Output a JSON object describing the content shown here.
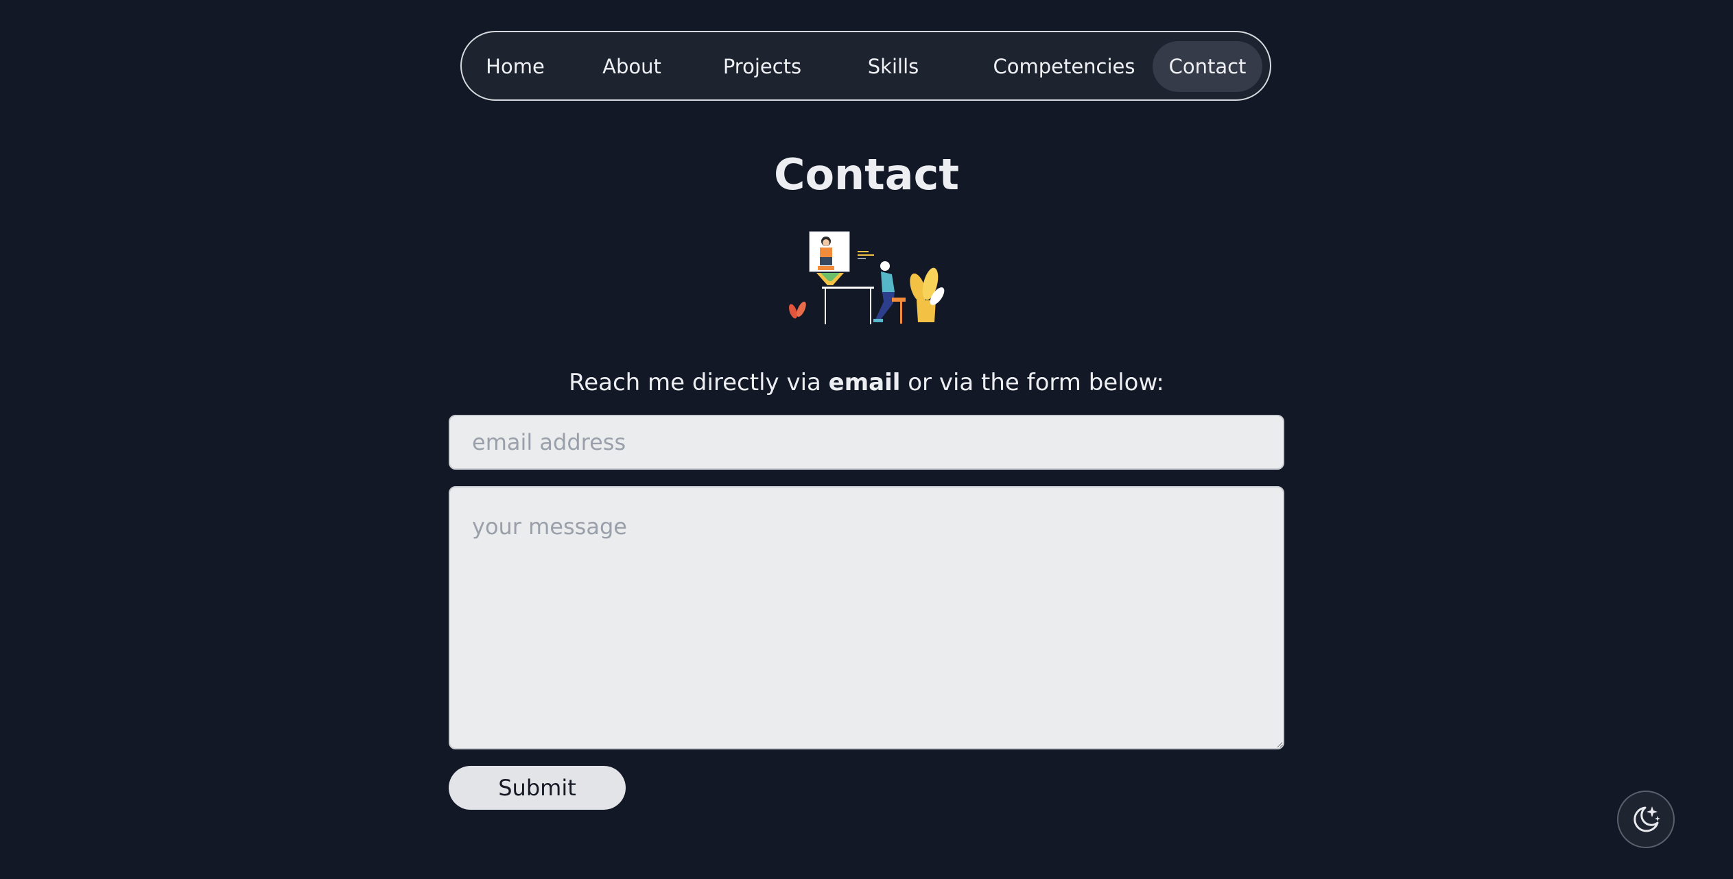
{
  "nav": {
    "items": [
      {
        "label": "Home"
      },
      {
        "label": "About"
      },
      {
        "label": "Projects"
      },
      {
        "label": "Skills"
      },
      {
        "label": "Competencies"
      },
      {
        "label": "Contact",
        "active": true
      }
    ]
  },
  "contact": {
    "title": "Contact",
    "intro_prefix": "Reach me directly via ",
    "intro_link": "email",
    "intro_suffix": " or via the form below:",
    "email_placeholder": "email address",
    "message_placeholder": "your message",
    "submit_label": "Submit"
  },
  "theme_toggle": {
    "icon": "moon-stars-icon"
  },
  "colors": {
    "background": "#131826",
    "nav_background": "#1e2330",
    "nav_active": "#363b49",
    "field_background": "#ebecee",
    "button_background": "#e3e4e8"
  }
}
